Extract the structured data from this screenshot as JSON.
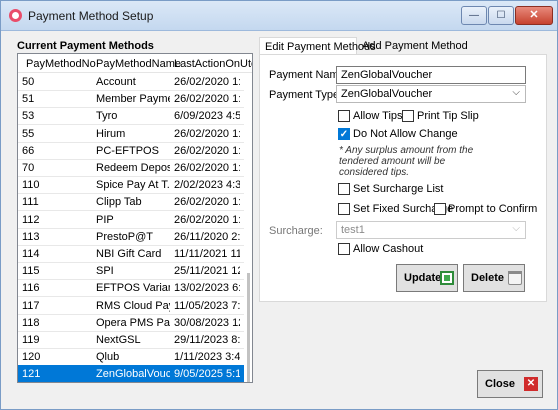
{
  "window": {
    "title": "Payment Method Setup",
    "controls": {
      "minimize": "—",
      "maximize": "☐",
      "close": "✕"
    }
  },
  "left_panel": {
    "title": "Current Payment Methods",
    "columns": [
      "PayMethodNo",
      "PayMethodName",
      "LastActionOnUtc"
    ],
    "rows": [
      [
        "50",
        "Account",
        "26/02/2020 1:..."
      ],
      [
        "51",
        "Member Payment",
        "26/02/2020 1:..."
      ],
      [
        "53",
        "Tyro",
        "6/09/2023 4:5..."
      ],
      [
        "55",
        "Hirum",
        "26/02/2020 1:..."
      ],
      [
        "66",
        "PC-EFTPOS",
        "26/02/2020 1:..."
      ],
      [
        "70",
        "Redeem Deposit",
        "26/02/2020 1:..."
      ],
      [
        "110",
        "Spice Pay At T...",
        "2/02/2023 4:3..."
      ],
      [
        "111",
        "Clipp Tab",
        "26/02/2020 1:..."
      ],
      [
        "112",
        "PIP",
        "26/02/2020 1:..."
      ],
      [
        "113",
        "PrestoP@T",
        "26/11/2020 2:..."
      ],
      [
        "114",
        "NBI Gift Card",
        "11/11/2021 11..."
      ],
      [
        "115",
        "SPI",
        "25/11/2021 12..."
      ],
      [
        "116",
        "EFTPOS Varian...",
        "13/02/2023 6:..."
      ],
      [
        "117",
        "RMS Cloud Pay...",
        "11/05/2023 7:..."
      ],
      [
        "118",
        "Opera PMS Pa...",
        "30/08/2023 12..."
      ],
      [
        "119",
        "NextGSL",
        "29/11/2023 8:..."
      ],
      [
        "120",
        "Qlub",
        "1/11/2023 3:4..."
      ],
      [
        "121",
        "ZenGlobalVouc...",
        "9/05/2025 5:1..."
      ]
    ],
    "selected_index": 17
  },
  "tabs": {
    "edit": "Edit Payment Methods",
    "add": "Add Payment Method"
  },
  "form": {
    "payment_name_label": "Payment Name:",
    "payment_name_value": "ZenGlobalVoucher",
    "payment_type_label": "Payment Type:",
    "payment_type_value": "ZenGlobalVoucher",
    "allow_tips": {
      "label": "Allow Tips",
      "checked": false
    },
    "print_tip_slip": {
      "label": "Print Tip Slip",
      "checked": false
    },
    "do_not_allow_change": {
      "label": "Do Not Allow Change",
      "checked": true
    },
    "note": "* Any surplus amount from the tendered amount will be considered tips.",
    "set_surcharge_list": {
      "label": "Set Surcharge List",
      "checked": false
    },
    "set_fixed_surcharge": {
      "label": "Set Fixed Surcharge",
      "checked": false
    },
    "prompt_to_confirm": {
      "label": "Prompt to Confirm",
      "checked": false
    },
    "surcharge_label": "Surcharge:",
    "surcharge_value": "test1",
    "allow_cashout": {
      "label": "Allow Cashout",
      "checked": false
    },
    "update_label": "Update",
    "delete_label": "Delete"
  },
  "footer": {
    "close_label": "Close"
  },
  "colors": {
    "selection": "#0078d7",
    "close_button": "#c6422f",
    "update_icon": "#2e8b3a"
  }
}
